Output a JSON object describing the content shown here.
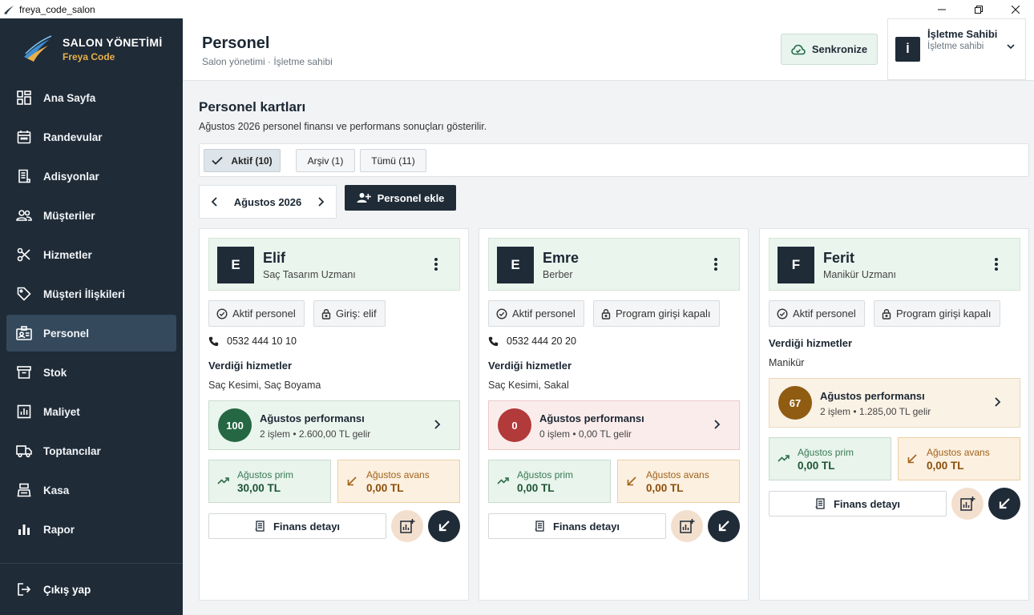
{
  "window": {
    "title": "freya_code_salon"
  },
  "sidebar": {
    "brand_title": "SALON YÖNETİMİ",
    "brand_sub": "Freya Code",
    "items": [
      {
        "label": "Ana Sayfa",
        "icon": "dashboard-icon"
      },
      {
        "label": "Randevular",
        "icon": "calendar-icon"
      },
      {
        "label": "Adisyonlar",
        "icon": "receipt-icon"
      },
      {
        "label": "Müşteriler",
        "icon": "people-icon"
      },
      {
        "label": "Hizmetler",
        "icon": "scissors-icon"
      },
      {
        "label": "Müşteri İlişkileri",
        "icon": "tag-icon"
      },
      {
        "label": "Personel",
        "icon": "badge-icon",
        "active": true
      },
      {
        "label": "Stok",
        "icon": "archive-icon"
      },
      {
        "label": "Maliyet",
        "icon": "chart-icon"
      },
      {
        "label": "Toptancılar",
        "icon": "truck-icon"
      },
      {
        "label": "Kasa",
        "icon": "register-icon"
      },
      {
        "label": "Rapor",
        "icon": "bar-chart-icon"
      }
    ],
    "logout": "Çıkış yap"
  },
  "header": {
    "title": "Personel",
    "subtitle": "Salon yönetimi · İşletme sahibi",
    "sync_label": "Senkronize",
    "user_initial": "İ",
    "user_name": "İşletme Sahibi",
    "user_role": "İşletme sahibi"
  },
  "main": {
    "section_title": "Personel kartları",
    "section_sub": "Ağustos 2026 personel finansı ve performans sonuçları gösterilir.",
    "filters": [
      "Aktif (10)",
      "Arşiv (1)",
      "Tümü (11)"
    ],
    "month": "Ağustos 2026",
    "add_label": "Personel ekle"
  },
  "cards": [
    {
      "initial": "E",
      "name": "Elif",
      "role": "Saç Tasarım Uzmanı",
      "chip1": "Aktif personel",
      "chip2": "Giriş: elif",
      "phone": "0532 444 10 10",
      "services_title": "Verdiği hizmetler",
      "services": "Saç Kesimi, Saç Boyama",
      "perf_score": "100",
      "perf_title": "Ağustos performansı",
      "perf_sub": "2 işlem • 2.600,00 TL gelir",
      "prim_label": "Ağustos prim",
      "prim_value": "30,00 TL",
      "avans_label": "Ağustos avans",
      "avans_value": "0,00 TL",
      "finance_label": "Finans detayı"
    },
    {
      "initial": "E",
      "name": "Emre",
      "role": "Berber",
      "chip1": "Aktif personel",
      "chip2": "Program girişi kapalı",
      "phone": "0532 444 20 20",
      "services_title": "Verdiği hizmetler",
      "services": "Saç Kesimi, Sakal",
      "perf_score": "0",
      "perf_title": "Ağustos performansı",
      "perf_sub": "0 işlem • 0,00 TL gelir",
      "prim_label": "Ağustos prim",
      "prim_value": "0,00 TL",
      "avans_label": "Ağustos avans",
      "avans_value": "0,00 TL",
      "finance_label": "Finans detayı"
    },
    {
      "initial": "F",
      "name": "Ferit",
      "role": "Manikür Uzmanı",
      "chip1": "Aktif personel",
      "chip2": "Program girişi kapalı",
      "phone": "",
      "services_title": "Verdiği hizmetler",
      "services": "Manikür",
      "perf_score": "67",
      "perf_title": "Ağustos performansı",
      "perf_sub": "2 işlem • 1.285,00 TL gelir",
      "prim_label": "Ağustos prim",
      "prim_value": "0,00 TL",
      "avans_label": "Ağustos avans",
      "avans_value": "0,00 TL",
      "finance_label": "Finans detayı"
    }
  ]
}
